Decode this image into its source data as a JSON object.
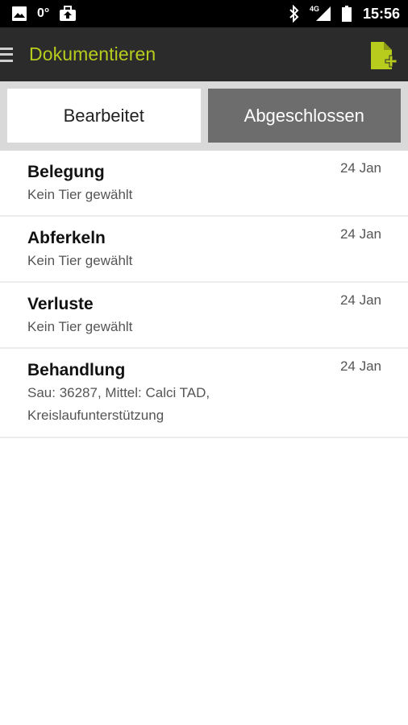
{
  "status_bar": {
    "temperature": "0°",
    "network": "4G",
    "time": "15:56"
  },
  "app_bar": {
    "title": "Dokumentieren",
    "accent_color": "#b8cc1e"
  },
  "tabs": [
    {
      "label": "Bearbeitet",
      "selected": true
    },
    {
      "label": "Abgeschlossen",
      "selected": false
    }
  ],
  "documents": [
    {
      "title": "Belegung",
      "subtitle": "Kein Tier gewählt",
      "date": "24 Jan"
    },
    {
      "title": "Abferkeln",
      "subtitle": "Kein Tier gewählt",
      "date": "24 Jan"
    },
    {
      "title": "Verluste",
      "subtitle": "Kein Tier gewählt",
      "date": "24 Jan"
    },
    {
      "title": "Behandlung",
      "subtitle": "Sau: 36287, Mittel: Calci TAD, Kreislaufunterstützung",
      "date": "24 Jan"
    }
  ]
}
